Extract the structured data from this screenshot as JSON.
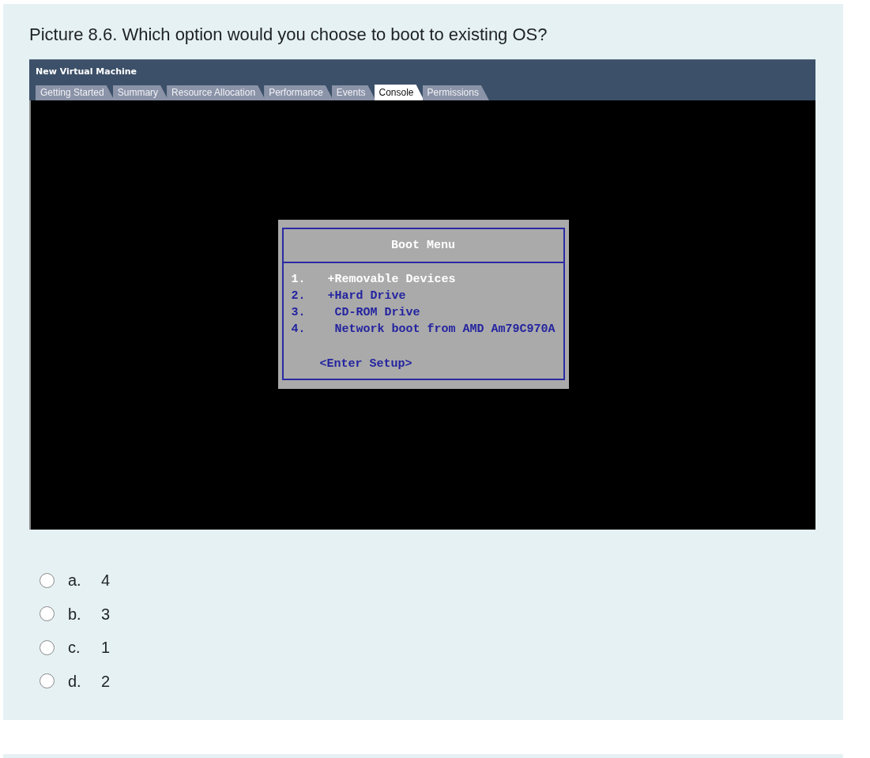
{
  "question": {
    "text": "Picture 8.6. Which option would you choose to boot to existing OS?"
  },
  "window": {
    "title": "New Virtual Machine",
    "tabs": [
      {
        "label": "Getting Started",
        "selected": false
      },
      {
        "label": "Summary",
        "selected": false
      },
      {
        "label": "Resource Allocation",
        "selected": false
      },
      {
        "label": "Performance",
        "selected": false
      },
      {
        "label": "Events",
        "selected": false
      },
      {
        "label": "Console",
        "selected": true
      },
      {
        "label": "Permissions",
        "selected": false
      }
    ],
    "console": {
      "boot_menu": {
        "title": "Boot Menu",
        "items": [
          {
            "number": "1.",
            "label": "+Removable Devices",
            "kind": "group",
            "selected": true
          },
          {
            "number": "2.",
            "label": "+Hard Drive",
            "kind": "group",
            "selected": false
          },
          {
            "number": "3.",
            "label": "CD-ROM Drive",
            "kind": "device",
            "selected": false
          },
          {
            "number": "4.",
            "label": "Network boot from AMD Am79C970A",
            "kind": "device",
            "selected": false
          }
        ],
        "setup_entry": "<Enter Setup>"
      }
    }
  },
  "options": [
    {
      "letter": "a.",
      "text": "4",
      "selected": false
    },
    {
      "letter": "b.",
      "text": "3",
      "selected": false
    },
    {
      "letter": "c.",
      "text": "1",
      "selected": false
    },
    {
      "letter": "d.",
      "text": "2",
      "selected": false
    }
  ]
}
